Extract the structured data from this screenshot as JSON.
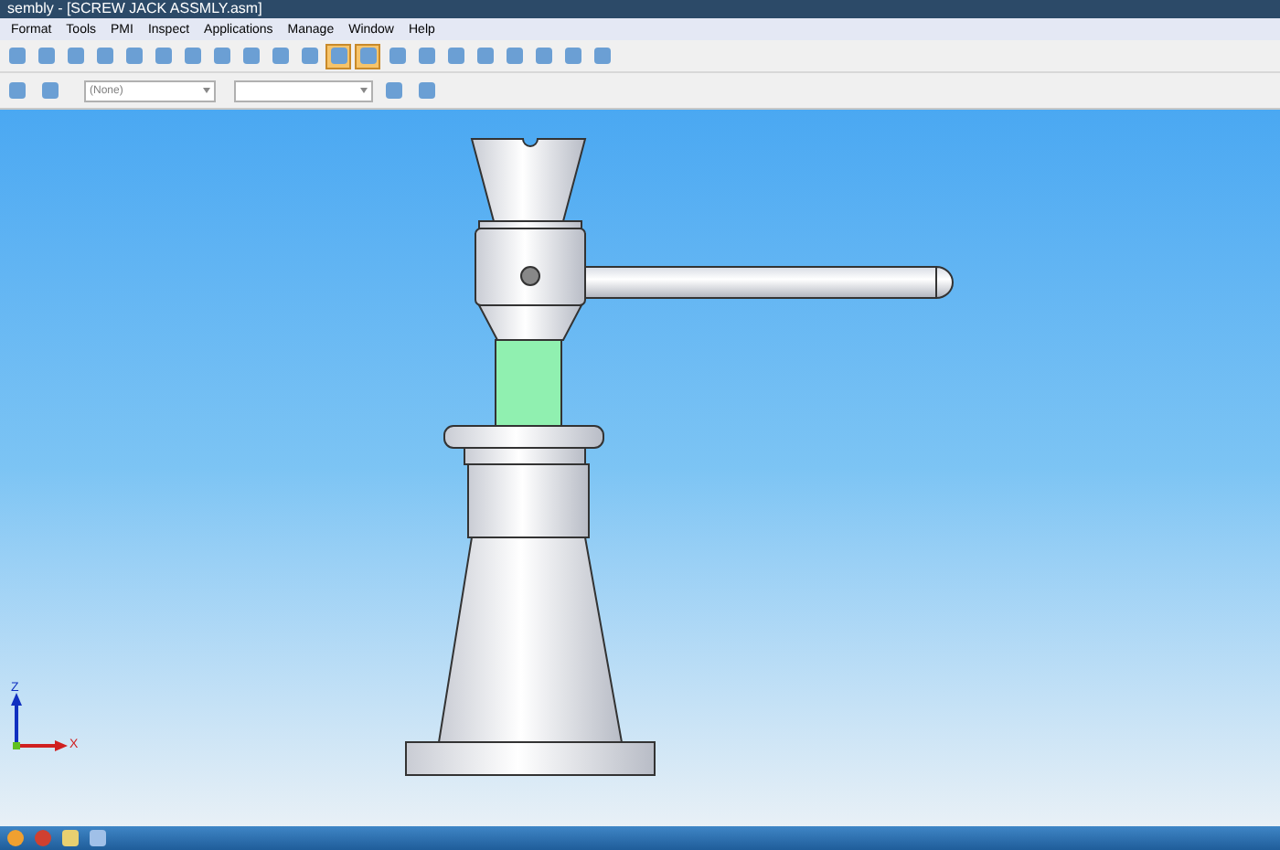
{
  "window": {
    "title": "sembly - [SCREW JACK ASSMLY.asm]"
  },
  "menu": [
    "Format",
    "Tools",
    "PMI",
    "Inspect",
    "Applications",
    "Manage",
    "Window",
    "Help"
  ],
  "toolbar": {
    "buttons": [
      {
        "selected": false
      },
      {
        "selected": false
      },
      {
        "selected": false
      },
      {
        "selected": false
      },
      {
        "selected": false
      },
      {
        "selected": false
      },
      {
        "selected": false
      },
      {
        "selected": false
      },
      {
        "selected": false
      },
      {
        "selected": false
      },
      {
        "selected": false
      },
      {
        "selected": true
      },
      {
        "selected": true
      },
      {
        "selected": false
      },
      {
        "selected": false
      },
      {
        "selected": false
      },
      {
        "selected": false
      },
      {
        "selected": false
      },
      {
        "selected": false
      },
      {
        "selected": false
      },
      {
        "selected": false
      }
    ]
  },
  "second_toolbar": {
    "dropdown_1": {
      "value": "(None)"
    }
  },
  "axes": {
    "z_label": "Z",
    "x_label": "X"
  }
}
